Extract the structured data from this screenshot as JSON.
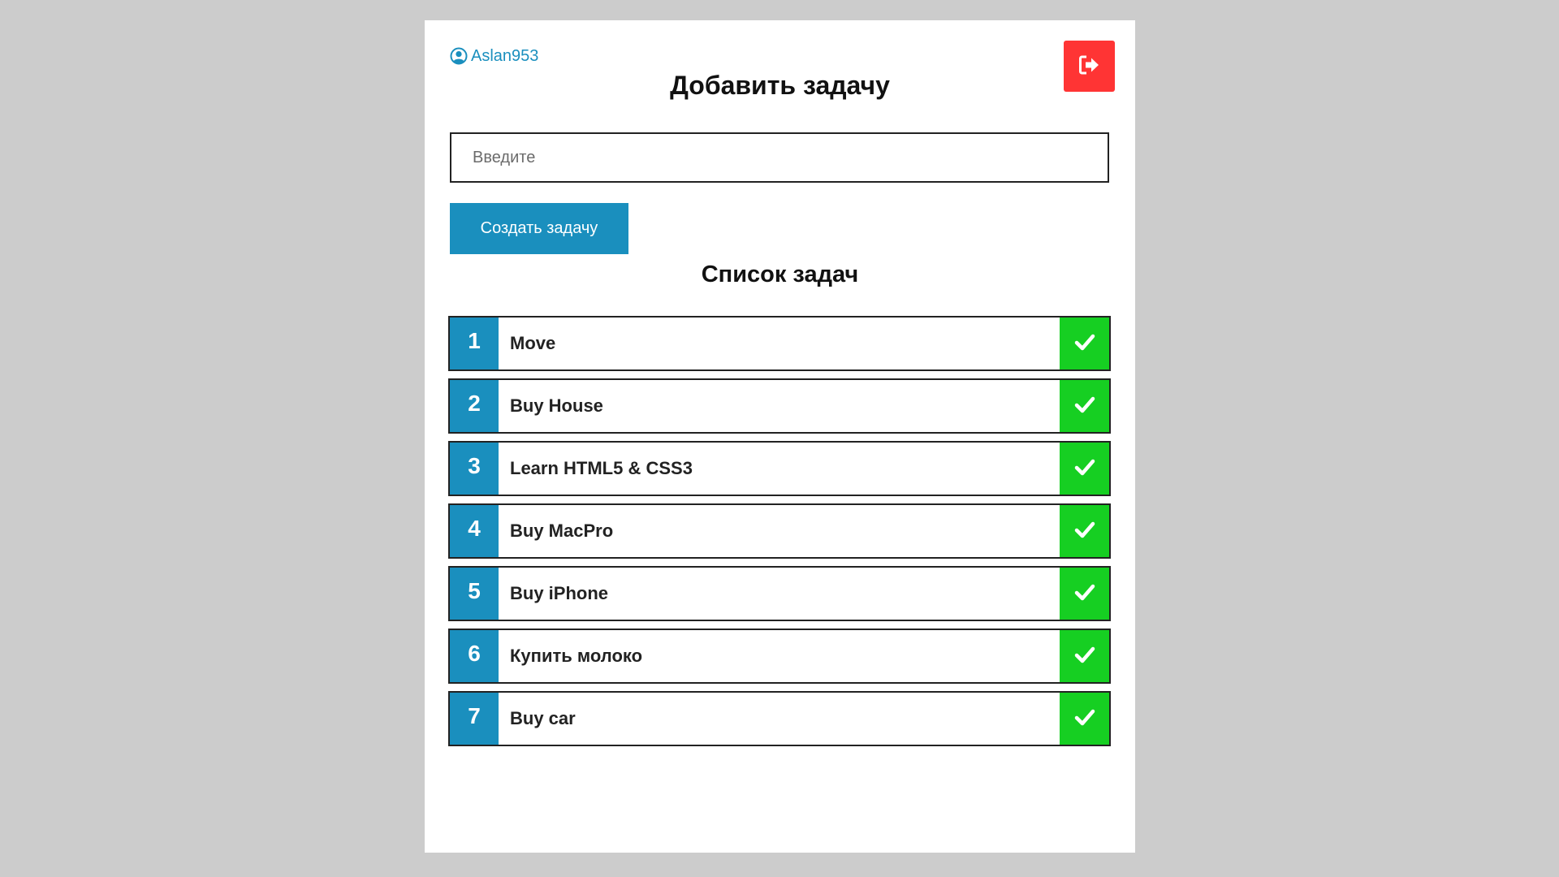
{
  "header": {
    "username": "Aslan953",
    "user_icon": "user-circle-icon",
    "logout_icon": "sign-out-icon",
    "logout_color": "#ff3434"
  },
  "form": {
    "title": "Добавить задачу",
    "input_placeholder": "Введите",
    "input_value": "",
    "create_label": "Создать задачу",
    "accent_color": "#1a8fbe"
  },
  "list": {
    "title": "Список задач",
    "done_icon": "check-icon",
    "done_color": "#16cf22",
    "items": [
      {
        "num": "1",
        "text": "Move"
      },
      {
        "num": "2",
        "text": "Buy House"
      },
      {
        "num": "3",
        "text": "Learn HTML5 & CSS3"
      },
      {
        "num": "4",
        "text": "Buy MacPro"
      },
      {
        "num": "5",
        "text": "Buy iPhone"
      },
      {
        "num": "6",
        "text": "Купить молоко"
      },
      {
        "num": "7",
        "text": "Buy car"
      }
    ]
  }
}
